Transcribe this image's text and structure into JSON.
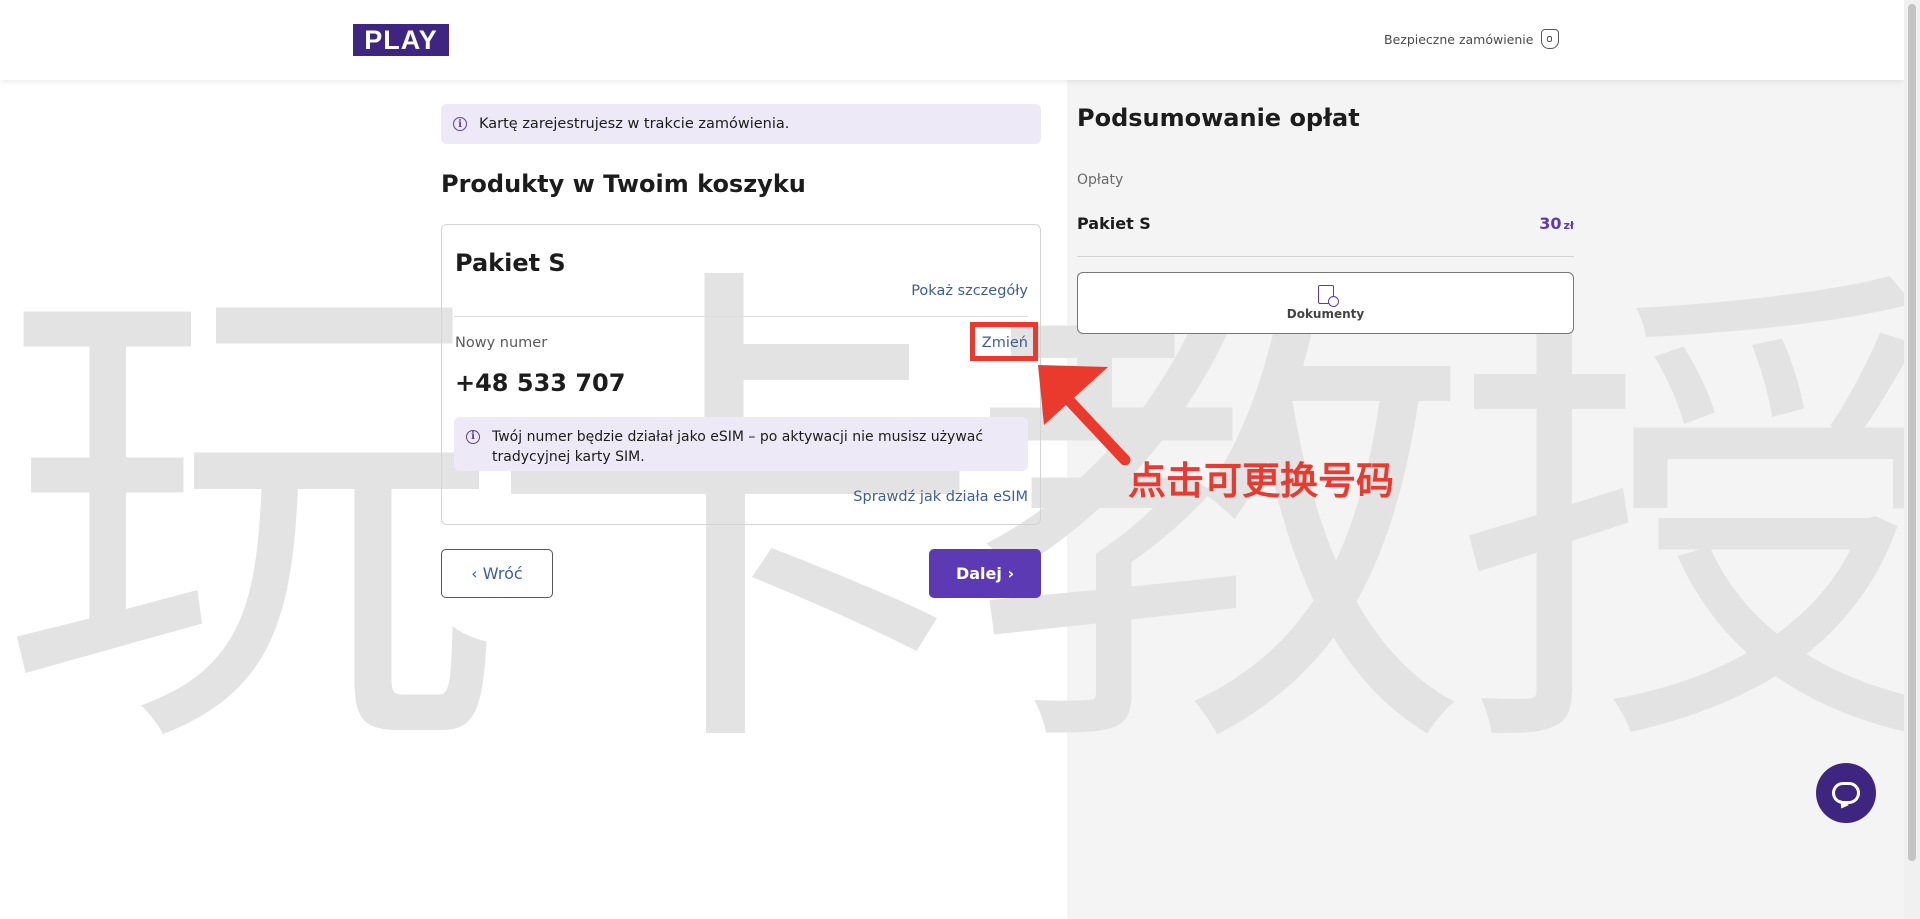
{
  "header": {
    "logo_text": "PLAY",
    "secure_label": "Bezpieczne zamówienie"
  },
  "info_banner": {
    "text": "Kartę zarejestrujesz w trakcie zamówienia."
  },
  "cart": {
    "title": "Produkty w Twoim koszyku",
    "package_name": "Pakiet S",
    "details_link": "Pokaż szczegóły",
    "number_label": "Nowy numer",
    "change_link": "Zmień",
    "phone_number": "+48 533 707",
    "esim_note": "Twój numer będzie działał jako eSIM – po aktywacji nie musisz używać tradycyjnej karty SIM.",
    "esim_link": "Sprawdź jak działa eSIM"
  },
  "buttons": {
    "back_label": "‹ Wróć",
    "next_label": "Dalej ›"
  },
  "summary": {
    "title": "Podsumowanie opłat",
    "fees_label": "Opłaty",
    "fee_name": "Pakiet S",
    "fee_amount": "30",
    "fee_currency": "zł",
    "documents_label": "Dokumenty"
  },
  "annotation": {
    "text": "点击可更换号码"
  },
  "watermark": {
    "text": "玩卡教授"
  },
  "colors": {
    "brand": "#3e2680",
    "accent": "#5b3ab3",
    "link": "#3e5d9a",
    "annotation": "#ea3a2e",
    "info_bg": "#ede9f7"
  },
  "icons": [
    "shield-lock-icon",
    "info-icon",
    "document-check-icon",
    "chat-icon"
  ]
}
